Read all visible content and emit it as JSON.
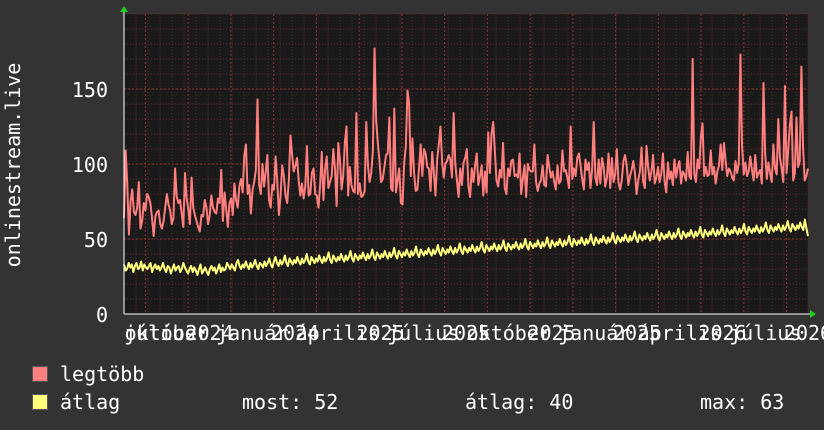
{
  "chart_data": {
    "type": "line",
    "ylabel": "onlinestream.live",
    "ylim": [
      0,
      200
    ],
    "yticks": [
      0,
      50,
      100,
      150
    ],
    "xtick_labels": [
      "július",
      "október",
      "2024",
      "január",
      "2024",
      "április",
      "2025",
      "július",
      "2025",
      "október",
      "2025",
      "január",
      "2025",
      "április",
      "2026",
      "július",
      "2026"
    ],
    "grid": true,
    "colors": {
      "legtobb": "#ff7f7f",
      "atlag": "#ffff7f",
      "background": "#333333",
      "plot": "#1a1a1a",
      "grid_minor": "#5a2a2a",
      "grid_major": "#8a3030"
    },
    "series": [
      {
        "name": "legtöbb",
        "color": "#ff7f7f",
        "values": [
          64,
          109,
          86,
          53,
          75,
          83,
          68,
          66,
          71,
          88,
          57,
          62,
          74,
          69,
          80,
          78,
          74,
          64,
          52,
          65,
          68,
          69,
          60,
          57,
          62,
          71,
          80,
          73,
          69,
          60,
          64,
          97,
          78,
          74,
          76,
          67,
          58,
          94,
          77,
          70,
          60,
          91,
          71,
          66,
          62,
          58,
          55,
          66,
          65,
          76,
          71,
          60,
          66,
          79,
          71,
          68,
          67,
          77,
          74,
          96,
          62,
          81,
          70,
          58,
          74,
          77,
          66,
          87,
          76,
          71,
          85,
          90,
          81,
          106,
          113,
          80,
          86,
          67,
          83,
          88,
          96,
          143,
          86,
          80,
          100,
          85,
          95,
          106,
          76,
          71,
          86,
          83,
          105,
          88,
          66,
          79,
          99,
          92,
          79,
          74,
          89,
          119,
          106,
          95,
          99,
          104,
          89,
          79,
          87,
          77,
          85,
          112,
          79,
          80,
          94,
          97,
          80,
          79,
          71,
          86,
          108,
          76,
          96,
          105,
          84,
          88,
          92,
          110,
          97,
          72,
          114,
          103,
          83,
          92,
          114,
          125,
          79,
          98,
          86,
          82,
          81,
          134,
          80,
          87,
          78,
          79,
          82,
          128,
          99,
          88,
          94,
          109,
          177,
          129,
          114,
          102,
          88,
          90,
          98,
          106,
          107,
          131,
          84,
          82,
          137,
          81,
          89,
          97,
          74,
          73,
          101,
          112,
          149,
          140,
          92,
          117,
          94,
          82,
          83,
          97,
          113,
          92,
          110,
          107,
          98,
          97,
          82,
          108,
          94,
          79,
          103,
          113,
          125,
          102,
          91,
          100,
          102,
          106,
          103,
          91,
          134,
          100,
          89,
          78,
          97,
          86,
          101,
          104,
          110,
          85,
          78,
          97,
          88,
          99,
          107,
          86,
          92,
          99,
          79,
          95,
          81,
          121,
          94,
          120,
          128,
          109,
          89,
          85,
          96,
          91,
          114,
          84,
          80,
          97,
          92,
          102,
          103,
          92,
          93,
          91,
          107,
          80,
          90,
          99,
          78,
          100,
          96,
          95,
          95,
          113,
          88,
          82,
          87,
          89,
          99,
          86,
          85,
          106,
          98,
          91,
          95,
          88,
          83,
          99,
          87,
          89,
          109,
          95,
          96,
          91,
          84,
          125,
          90,
          97,
          92,
          104,
          107,
          99,
          90,
          83,
          103,
          96,
          101,
          84,
          96,
          128,
          91,
          86,
          103,
          87,
          104,
          98,
          85,
          91,
          107,
          84,
          104,
          88,
          93,
          110,
          88,
          83,
          89,
          102,
          106,
          99,
          86,
          92,
          96,
          102,
          94,
          80,
          89,
          95,
          111,
          88,
          84,
          112,
          98,
          89,
          95,
          106,
          87,
          91,
          98,
          88,
          94,
          107,
          88,
          81,
          101,
          90,
          95,
          86,
          103,
          91,
          98,
          102,
          87,
          95,
          93,
          89,
          108,
          92,
          90,
          170,
          93,
          88,
          103,
          97,
          118,
          127,
          92,
          98,
          92,
          93,
          109,
          93,
          98,
          87,
          95,
          99,
          113,
          96,
          114,
          102,
          92,
          97,
          95,
          91,
          89,
          102,
          94,
          100,
          173,
          112,
          93,
          101,
          92,
          95,
          105,
          96,
          89,
          106,
          91,
          94,
          96,
          87,
          154,
          108,
          90,
          101,
          94,
          88,
          113,
          97,
          93,
          130,
          104,
          97,
          88,
          152,
          94,
          109,
          126,
          135,
          89,
          94,
          131,
          98,
          102,
          165,
          111,
          89,
          92,
          97
        ],
        "range_note_x": "series spans the full x range"
      },
      {
        "name": "átlag",
        "color": "#ffff7f",
        "values": [
          33,
          29,
          30,
          34,
          31,
          33,
          28,
          32,
          34,
          30,
          31,
          35,
          29,
          33,
          31,
          30,
          32,
          34,
          28,
          31,
          33,
          30,
          32,
          29,
          31,
          34,
          30,
          28,
          32,
          31,
          27,
          30,
          33,
          29,
          31,
          32,
          28,
          30,
          34,
          31,
          29,
          27,
          30,
          32,
          28,
          31,
          29,
          26,
          30,
          33,
          27,
          29,
          31,
          28,
          26,
          30,
          32,
          29,
          31,
          27,
          30,
          33,
          28,
          31,
          29,
          30,
          34,
          32,
          30,
          33,
          31,
          29,
          34,
          36,
          32,
          30,
          33,
          31,
          35,
          32,
          30,
          34,
          31,
          33,
          36,
          32,
          30,
          34,
          33,
          31,
          35,
          32,
          34,
          37,
          33,
          31,
          35,
          38,
          34,
          32,
          36,
          33,
          35,
          39,
          34,
          32,
          37,
          35,
          33,
          36,
          34,
          38,
          35,
          33,
          37,
          34,
          36,
          40,
          35,
          33,
          38,
          36,
          34,
          37,
          35,
          39,
          36,
          34,
          38,
          35,
          37,
          41,
          36,
          34,
          39,
          37,
          35,
          38,
          36,
          40,
          37,
          35,
          39,
          36,
          38,
          42,
          37,
          35,
          40,
          38,
          36,
          39,
          37,
          41,
          38,
          36,
          40,
          37,
          39,
          43,
          38,
          36,
          41,
          39,
          37,
          40,
          38,
          42,
          39,
          37,
          41,
          38,
          40,
          44,
          39,
          37,
          42,
          40,
          38,
          41,
          39,
          43,
          40,
          38,
          42,
          39,
          41,
          45,
          40,
          38,
          43,
          41,
          39,
          42,
          40,
          44,
          41,
          39,
          43,
          40,
          42,
          46,
          41,
          39,
          44,
          42,
          40,
          43,
          41,
          45,
          42,
          40,
          44,
          41,
          43,
          47,
          42,
          40,
          45,
          43,
          41,
          44,
          42,
          46,
          43,
          41,
          45,
          42,
          44,
          48,
          43,
          41,
          46,
          44,
          42,
          45,
          43,
          47,
          44,
          42,
          46,
          43,
          45,
          49,
          44,
          42,
          47,
          45,
          43,
          46,
          44,
          48,
          45,
          43,
          47,
          44,
          46,
          50,
          45,
          43,
          48,
          46,
          44,
          47,
          45,
          49,
          46,
          44,
          48,
          45,
          47,
          51,
          46,
          44,
          49,
          47,
          45,
          48,
          46,
          50,
          47,
          45,
          49,
          46,
          48,
          52,
          47,
          45,
          50,
          48,
          46,
          49,
          47,
          51,
          48,
          46,
          50,
          47,
          49,
          53,
          48,
          46,
          51,
          49,
          47,
          50,
          48,
          52,
          49,
          47,
          51,
          48,
          50,
          54,
          49,
          47,
          52,
          50,
          48,
          51,
          49,
          53,
          50,
          48,
          52,
          49,
          51,
          55,
          50,
          48,
          53,
          51,
          49,
          52,
          50,
          54,
          51,
          49,
          53,
          50,
          52,
          56,
          51,
          49,
          54,
          52,
          50,
          53,
          51,
          55,
          52,
          50,
          54,
          51,
          53,
          57,
          52,
          50,
          55,
          53,
          51,
          54,
          52,
          56,
          53,
          51,
          55,
          52,
          54,
          58,
          53,
          51,
          56,
          54,
          52,
          55,
          53,
          57,
          54,
          52,
          56,
          53,
          55,
          59,
          54,
          52,
          57,
          55,
          53,
          56,
          54,
          58,
          55,
          53,
          57,
          54,
          56,
          60,
          55,
          53,
          58,
          56,
          54,
          57,
          55,
          59,
          56,
          54,
          58,
          55,
          57,
          61,
          56,
          54,
          59,
          57,
          55,
          58,
          56,
          60,
          57,
          55,
          59,
          56,
          58,
          62,
          57,
          55,
          60,
          58,
          56,
          59,
          57,
          61,
          58,
          56,
          63,
          57,
          52
        ]
      }
    ]
  },
  "legend": [
    {
      "name": "legtöbb",
      "color": "#ff7f7f"
    },
    {
      "name": "átlag",
      "color": "#ffff7f"
    }
  ],
  "stats": {
    "most_label": "most:",
    "most_value": "52",
    "atlag_label": "átlag:",
    "atlag_value": "40",
    "max_label": "max:",
    "max_value": "63"
  }
}
